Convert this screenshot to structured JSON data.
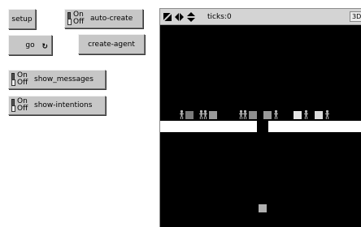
{
  "buttons": {
    "setup": "setup",
    "go": "go",
    "go_forever_symbol": "↻",
    "create_agent": "create-agent"
  },
  "switches": {
    "auto_create": {
      "label": "auto-create",
      "on": "On",
      "off": "Off",
      "state": "off"
    },
    "show_messages": {
      "label": "show_messages",
      "on": "On",
      "off": "Off",
      "state": "off"
    },
    "show_intentions": {
      "label": "show-intentions",
      "on": "On",
      "off": "Off",
      "state": "off"
    }
  },
  "view": {
    "ticks_label": "ticks:",
    "ticks_value": "0",
    "three_d_label": "3D",
    "toolbar_icons": [
      "view-shape-icon",
      "horizontal-arrows-icon",
      "vertical-arrows-icon"
    ],
    "colors": {
      "background": "#000000",
      "road": "#ffffff",
      "agent": "#b0b0b0",
      "box_dark": "#808080",
      "box_light": "#e0e0e0"
    }
  }
}
